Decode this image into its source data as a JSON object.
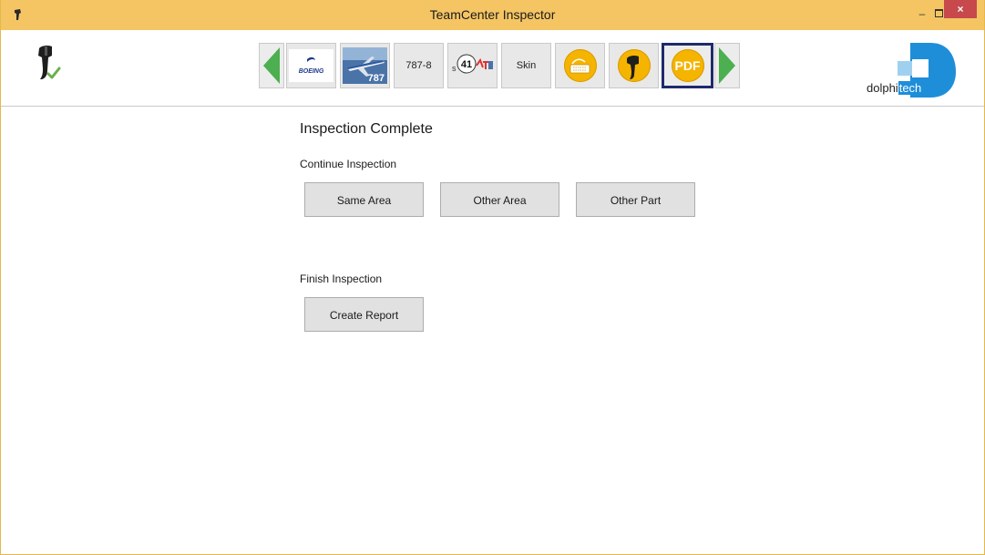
{
  "window": {
    "title": "TeamCenter Inspector",
    "minimize_glyph": "–",
    "close_glyph": "×"
  },
  "toolbar": {
    "breadcrumbs": [
      {
        "name": "boeing-logo",
        "label": "BOEING"
      },
      {
        "name": "aircraft-787",
        "label": "787"
      },
      {
        "name": "model",
        "label": "787-8"
      },
      {
        "name": "section",
        "label": "41"
      },
      {
        "name": "part",
        "label": "Skin"
      },
      {
        "name": "inspection-probe-keyboard",
        "label": ""
      },
      {
        "name": "probe",
        "label": ""
      },
      {
        "name": "pdf",
        "label": "PDF"
      }
    ]
  },
  "logo": {
    "text_plain": "dolphi",
    "text_highlight": "tech"
  },
  "content": {
    "heading": "Inspection Complete",
    "continue_label": "Continue Inspection",
    "buttons_continue": [
      "Same Area",
      "Other Area",
      "Other Part"
    ],
    "finish_label": "Finish Inspection",
    "create_report": "Create Report"
  },
  "colors": {
    "titlebar": "#f5c564",
    "close": "#c7494b",
    "nav_arrow": "#4caf50",
    "gold": "#f4b400",
    "active_border": "#1f2a6b",
    "brand_blue": "#1e8ed9"
  }
}
